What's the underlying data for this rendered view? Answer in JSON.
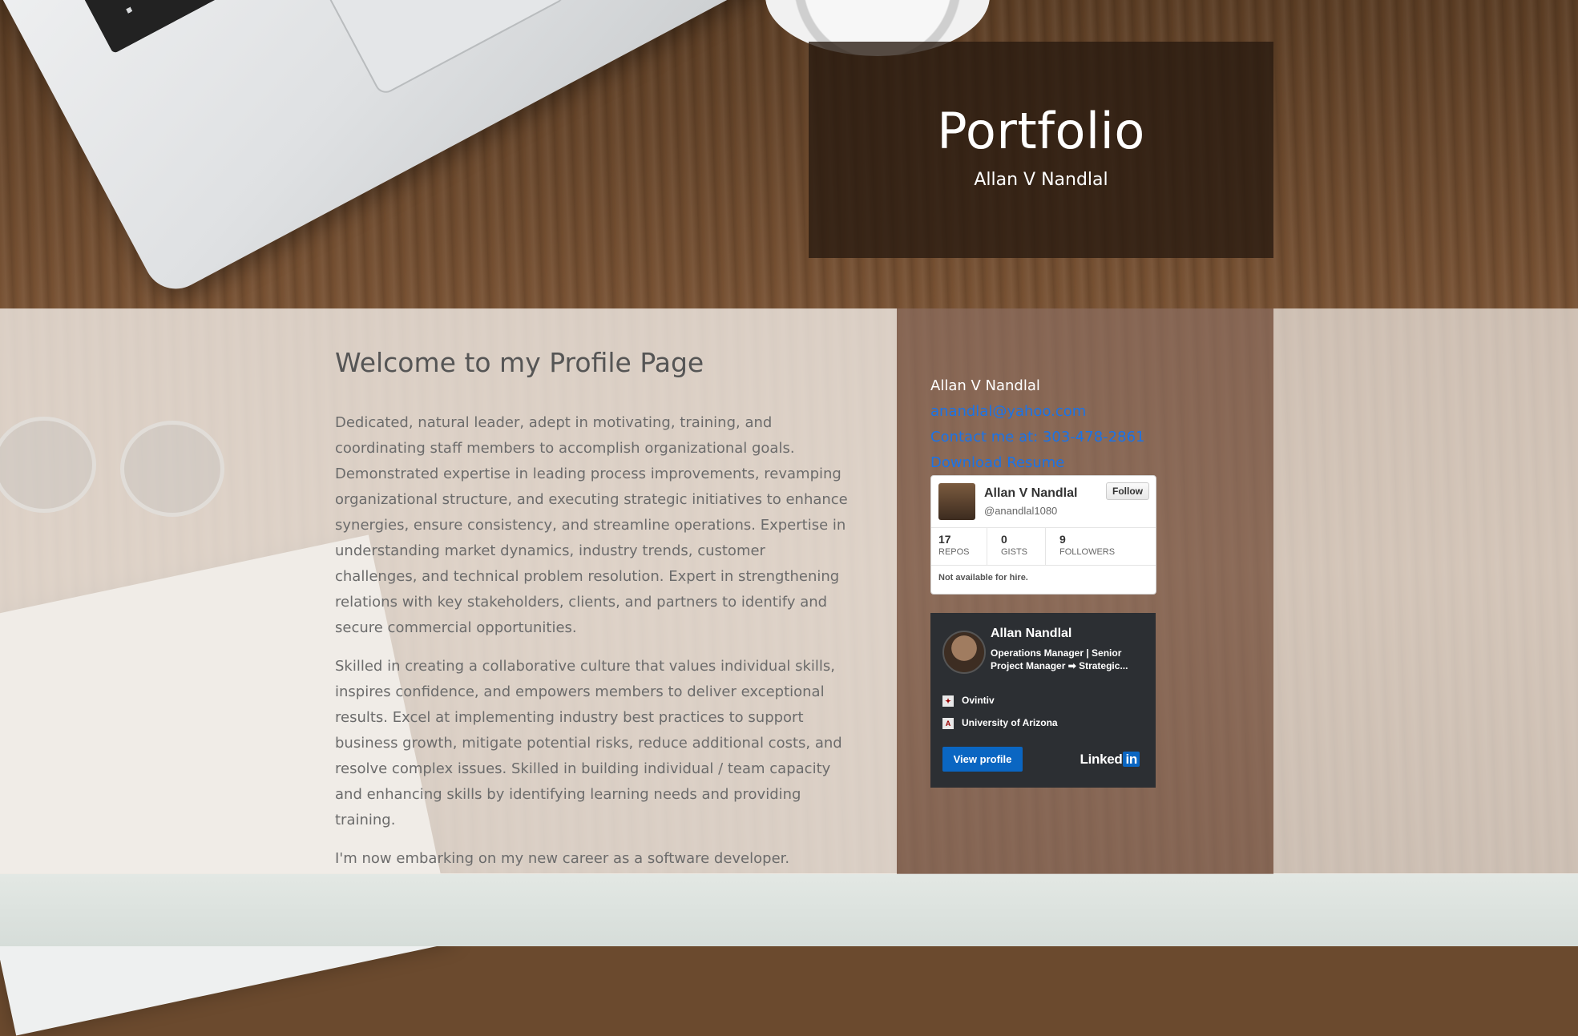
{
  "header": {
    "title": "Portfolio",
    "subtitle": "Allan V Nandlal"
  },
  "main": {
    "heading": "Welcome to my Profile Page",
    "paragraphs": [
      "Dedicated, natural leader, adept in motivating, training, and coordinating staff members to accomplish organizational goals. Demonstrated expertise in leading process improvements, revamping organizational structure, and executing strategic initiatives to enhance synergies, ensure consistency, and streamline operations. Expertise in understanding market dynamics, industry trends, customer challenges, and technical problem resolution. Expert in strengthening relations with key stakeholders, clients, and partners to identify and secure commercial opportunities.",
      "Skilled in creating a collaborative culture that values individual skills, inspires confidence, and empowers members to deliver exceptional results. Excel at implementing industry best practices to support business growth, mitigate potential risks, reduce additional costs, and resolve complex issues. Skilled in building individual / team capacity and enhancing skills by identifying learning needs and providing training.",
      "I'm now embarking on my new career as a software developer."
    ]
  },
  "sidebar": {
    "name": "Allan V Nandlal",
    "email": "anandlal@yahoo.com",
    "phone": "Contact me at: 303-478-2861",
    "resume": "Download Resume"
  },
  "github_card": {
    "name": "Allan V Nandlal",
    "handle": "@anandlal1080",
    "follow_label": "Follow",
    "stats": [
      {
        "num": "17",
        "label": "REPOS"
      },
      {
        "num": "0",
        "label": "GISTS"
      },
      {
        "num": "9",
        "label": "FOLLOWERS"
      }
    ],
    "hire": "Not available for hire."
  },
  "linkedin_card": {
    "name": "Allan Nandlal",
    "title": "Operations Manager | Senior Project Manager ➡ Strategic...",
    "company": "Ovintiv",
    "school": "University of Arizona",
    "button": "View profile",
    "logo_text": "Linked",
    "logo_in": "in"
  },
  "colors": {
    "link": "#1a73e8",
    "linkedin_blue": "#0a66c2",
    "hero_overlay": "#281a10"
  }
}
